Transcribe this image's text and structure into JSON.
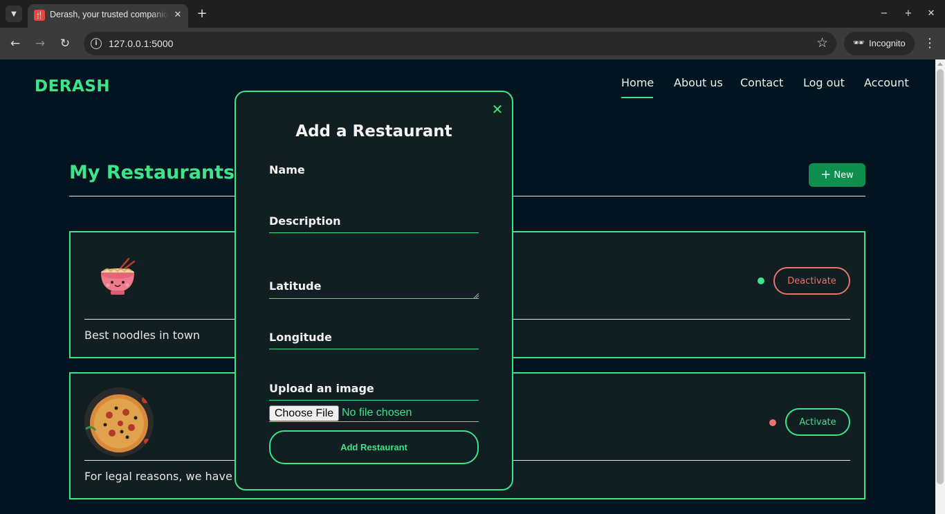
{
  "browser": {
    "tab_title": "Derash, your trusted companion",
    "tab_favicon": "restaurant-icon",
    "url": "127.0.0.1:5000",
    "incognito_label": "Incognito",
    "new_tab_symbol": "+",
    "icons": {
      "back": "←",
      "forward": "→",
      "reload": "↻",
      "star": "☆",
      "close": "✕",
      "minimize": "−",
      "maximize": "+",
      "menu": "⋮"
    }
  },
  "site": {
    "brand": "DERASH",
    "nav": [
      {
        "label": "Home",
        "active": true
      },
      {
        "label": "About us",
        "active": false
      },
      {
        "label": "Contact",
        "active": false
      },
      {
        "label": "Log out",
        "active": false
      },
      {
        "label": "Account",
        "active": false
      }
    ]
  },
  "restaurants": {
    "title": "My Restaurants",
    "new_button": "New",
    "items": [
      {
        "description": "Best noodles in town",
        "status": "active",
        "status_color": "#3ee48a",
        "action_label": "Deactivate",
        "action_color": "#e9746c",
        "image": "noodle-bowl"
      },
      {
        "description": "For legal reasons, we have to",
        "status": "inactive",
        "status_color": "#e9746c",
        "action_label": "Activate",
        "action_color": "#3ee48a",
        "image": "pizza"
      }
    ]
  },
  "modal": {
    "title": "Add a Restaurant",
    "fields": {
      "name": "Name",
      "description": "Description",
      "latitude": "Latitude",
      "longitude": "Longitude",
      "image": "Upload an image"
    },
    "choose_file": "Choose File",
    "no_file": "No file chosen",
    "submit": "Add Restaurant"
  },
  "colors": {
    "accent": "#3ee48a",
    "background": "#011420",
    "card": "#111e22",
    "danger": "#e9746c",
    "new_button": "#0f8f4e"
  }
}
